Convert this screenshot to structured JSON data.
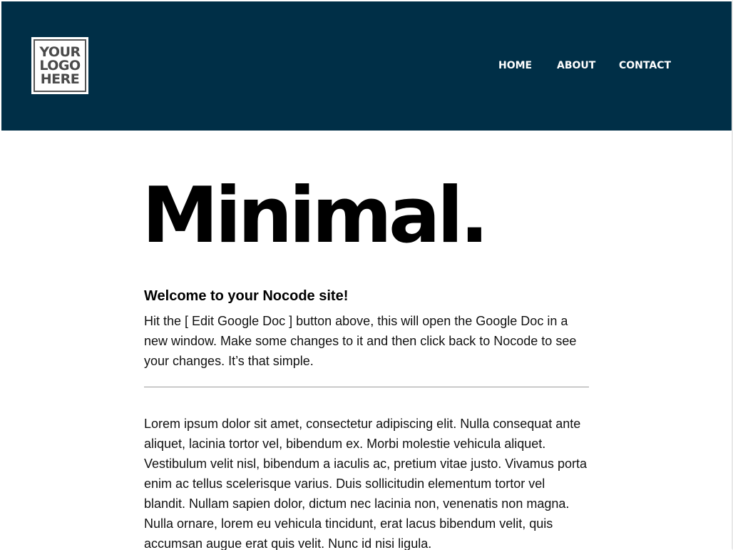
{
  "header": {
    "logo": {
      "line1": "YOUR",
      "line2": "LOGO",
      "line3": "HERE"
    },
    "nav": [
      {
        "label": "HOME"
      },
      {
        "label": "ABOUT"
      },
      {
        "label": "CONTACT"
      }
    ]
  },
  "main": {
    "hero_title": "Minimal.",
    "welcome_heading": "Welcome to your Nocode site!",
    "intro_text": "Hit the [ Edit Google Doc ] button above, this will open the Google Doc in a new window. Make some changes to it and then click back to Nocode to see your changes. It’s that simple.",
    "body_text": "Lorem ipsum dolor sit amet, consectetur adipiscing elit. Nulla consequat ante aliquet, lacinia tortor vel, bibendum ex. Morbi molestie vehicula aliquet. Vestibulum velit nisl, bibendum a iaculis ac, pretium vitae justo. Vivamus porta enim ac tellus scelerisque varius. Duis sollicitudin elementum tortor vel blandit. Nullam sapien dolor, dictum nec lacinia non, venenatis non magna. Nulla ornare, lorem eu vehicula tincidunt, erat lacus bibendum velit, quis accumsan augue erat quis velit. Nunc id nisi ligula."
  },
  "colors": {
    "header_bg": "#002f47",
    "nav_text": "#ffffff",
    "title_text": "#000000"
  }
}
